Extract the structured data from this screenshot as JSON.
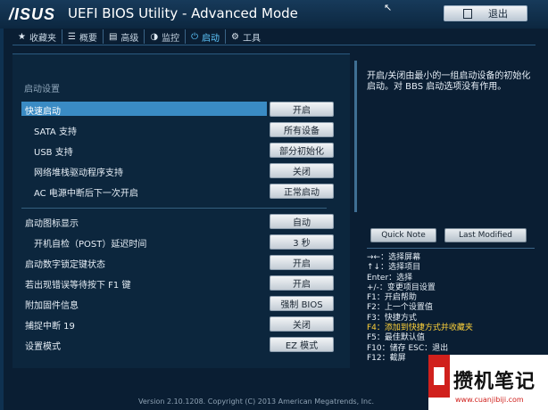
{
  "header": {
    "logo": "/ISUS",
    "title": "UEFI BIOS Utility - Advanced Mode",
    "exit_label": "退出"
  },
  "tabs": [
    {
      "icon": "★",
      "label": "收藏夹"
    },
    {
      "icon": "☰",
      "label": "概要"
    },
    {
      "icon": "▤",
      "label": "高级"
    },
    {
      "icon": "◑",
      "label": "监控"
    },
    {
      "icon": "⏻",
      "label": "启动"
    },
    {
      "icon": "⚙",
      "label": "工具"
    }
  ],
  "main": {
    "section_title": "启动设置",
    "rows": [
      {
        "label": "快速启动",
        "value": "开启"
      },
      {
        "label": "SATA 支持",
        "value": "所有设备"
      },
      {
        "label": "USB 支持",
        "value": "部分初始化"
      },
      {
        "label": "网络堆栈驱动程序支持",
        "value": "关闭"
      },
      {
        "label": "AC 电源中断后下一次开启",
        "value": "正常启动"
      },
      {
        "label": "启动图标显示",
        "value": "自动"
      },
      {
        "label": "开机自检（POST）延迟时间",
        "value": "3 秒"
      },
      {
        "label": "启动数字锁定键状态",
        "value": "开启"
      },
      {
        "label": "若出现错误等待按下 F1 键",
        "value": "开启"
      },
      {
        "label": "附加固件信息",
        "value": "强制 BIOS"
      },
      {
        "label": "捕捉中断 19",
        "value": "关闭"
      },
      {
        "label": "设置模式",
        "value": "EZ 模式"
      }
    ]
  },
  "help": {
    "text": "开启/关闭由最小的一组启动设备的初始化启动。对 BBS 启动选项没有作用。"
  },
  "buttons": {
    "quick_note": "Quick Note",
    "last_modified": "Last Modified"
  },
  "keys": [
    {
      "text": "→←：选择屏幕",
      "highlight": false
    },
    {
      "text": "↑↓：选择项目",
      "highlight": false
    },
    {
      "text": "Enter：选择",
      "highlight": false
    },
    {
      "text": "+/-：变更项目设置",
      "highlight": false
    },
    {
      "text": "F1：开启帮助",
      "highlight": false
    },
    {
      "text": "F2：上一个设置值",
      "highlight": false
    },
    {
      "text": "F3：快捷方式",
      "highlight": false
    },
    {
      "text": "F4：添加到快捷方式并收藏夹",
      "highlight": true
    },
    {
      "text": "F5：最佳默认值",
      "highlight": false
    },
    {
      "text": "F10：储存  ESC：退出",
      "highlight": false
    },
    {
      "text": "F12：截屏",
      "highlight": false
    }
  ],
  "footer": "Version 2.10.1208. Copyright (C) 2013 American Megatrends, Inc.",
  "watermark": {
    "text": "攒机笔记",
    "url": "www.cuanjibiji.com"
  }
}
